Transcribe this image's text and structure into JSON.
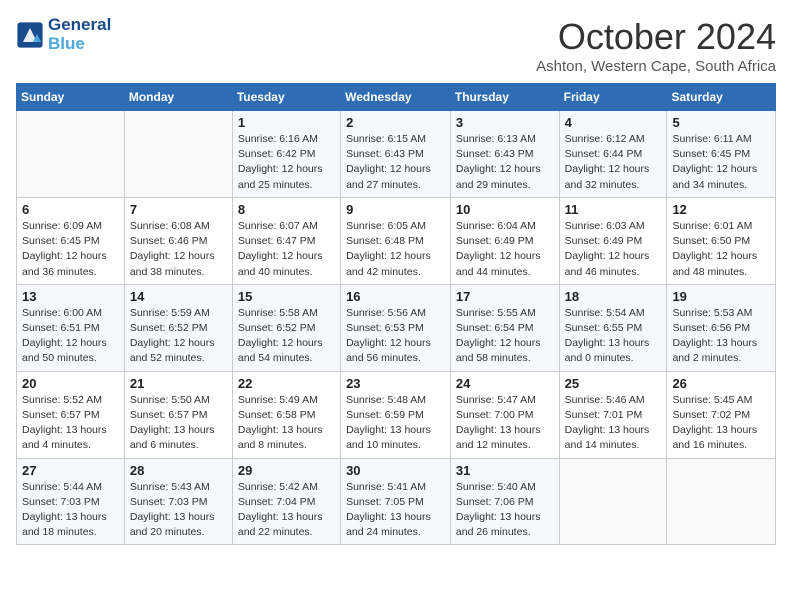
{
  "header": {
    "logo_line1": "General",
    "logo_line2": "Blue",
    "month": "October 2024",
    "location": "Ashton, Western Cape, South Africa"
  },
  "weekdays": [
    "Sunday",
    "Monday",
    "Tuesday",
    "Wednesday",
    "Thursday",
    "Friday",
    "Saturday"
  ],
  "weeks": [
    [
      {
        "day": "",
        "sunrise": "",
        "sunset": "",
        "daylight": ""
      },
      {
        "day": "",
        "sunrise": "",
        "sunset": "",
        "daylight": ""
      },
      {
        "day": "1",
        "sunrise": "Sunrise: 6:16 AM",
        "sunset": "Sunset: 6:42 PM",
        "daylight": "Daylight: 12 hours and 25 minutes."
      },
      {
        "day": "2",
        "sunrise": "Sunrise: 6:15 AM",
        "sunset": "Sunset: 6:43 PM",
        "daylight": "Daylight: 12 hours and 27 minutes."
      },
      {
        "day": "3",
        "sunrise": "Sunrise: 6:13 AM",
        "sunset": "Sunset: 6:43 PM",
        "daylight": "Daylight: 12 hours and 29 minutes."
      },
      {
        "day": "4",
        "sunrise": "Sunrise: 6:12 AM",
        "sunset": "Sunset: 6:44 PM",
        "daylight": "Daylight: 12 hours and 32 minutes."
      },
      {
        "day": "5",
        "sunrise": "Sunrise: 6:11 AM",
        "sunset": "Sunset: 6:45 PM",
        "daylight": "Daylight: 12 hours and 34 minutes."
      }
    ],
    [
      {
        "day": "6",
        "sunrise": "Sunrise: 6:09 AM",
        "sunset": "Sunset: 6:45 PM",
        "daylight": "Daylight: 12 hours and 36 minutes."
      },
      {
        "day": "7",
        "sunrise": "Sunrise: 6:08 AM",
        "sunset": "Sunset: 6:46 PM",
        "daylight": "Daylight: 12 hours and 38 minutes."
      },
      {
        "day": "8",
        "sunrise": "Sunrise: 6:07 AM",
        "sunset": "Sunset: 6:47 PM",
        "daylight": "Daylight: 12 hours and 40 minutes."
      },
      {
        "day": "9",
        "sunrise": "Sunrise: 6:05 AM",
        "sunset": "Sunset: 6:48 PM",
        "daylight": "Daylight: 12 hours and 42 minutes."
      },
      {
        "day": "10",
        "sunrise": "Sunrise: 6:04 AM",
        "sunset": "Sunset: 6:49 PM",
        "daylight": "Daylight: 12 hours and 44 minutes."
      },
      {
        "day": "11",
        "sunrise": "Sunrise: 6:03 AM",
        "sunset": "Sunset: 6:49 PM",
        "daylight": "Daylight: 12 hours and 46 minutes."
      },
      {
        "day": "12",
        "sunrise": "Sunrise: 6:01 AM",
        "sunset": "Sunset: 6:50 PM",
        "daylight": "Daylight: 12 hours and 48 minutes."
      }
    ],
    [
      {
        "day": "13",
        "sunrise": "Sunrise: 6:00 AM",
        "sunset": "Sunset: 6:51 PM",
        "daylight": "Daylight: 12 hours and 50 minutes."
      },
      {
        "day": "14",
        "sunrise": "Sunrise: 5:59 AM",
        "sunset": "Sunset: 6:52 PM",
        "daylight": "Daylight: 12 hours and 52 minutes."
      },
      {
        "day": "15",
        "sunrise": "Sunrise: 5:58 AM",
        "sunset": "Sunset: 6:52 PM",
        "daylight": "Daylight: 12 hours and 54 minutes."
      },
      {
        "day": "16",
        "sunrise": "Sunrise: 5:56 AM",
        "sunset": "Sunset: 6:53 PM",
        "daylight": "Daylight: 12 hours and 56 minutes."
      },
      {
        "day": "17",
        "sunrise": "Sunrise: 5:55 AM",
        "sunset": "Sunset: 6:54 PM",
        "daylight": "Daylight: 12 hours and 58 minutes."
      },
      {
        "day": "18",
        "sunrise": "Sunrise: 5:54 AM",
        "sunset": "Sunset: 6:55 PM",
        "daylight": "Daylight: 13 hours and 0 minutes."
      },
      {
        "day": "19",
        "sunrise": "Sunrise: 5:53 AM",
        "sunset": "Sunset: 6:56 PM",
        "daylight": "Daylight: 13 hours and 2 minutes."
      }
    ],
    [
      {
        "day": "20",
        "sunrise": "Sunrise: 5:52 AM",
        "sunset": "Sunset: 6:57 PM",
        "daylight": "Daylight: 13 hours and 4 minutes."
      },
      {
        "day": "21",
        "sunrise": "Sunrise: 5:50 AM",
        "sunset": "Sunset: 6:57 PM",
        "daylight": "Daylight: 13 hours and 6 minutes."
      },
      {
        "day": "22",
        "sunrise": "Sunrise: 5:49 AM",
        "sunset": "Sunset: 6:58 PM",
        "daylight": "Daylight: 13 hours and 8 minutes."
      },
      {
        "day": "23",
        "sunrise": "Sunrise: 5:48 AM",
        "sunset": "Sunset: 6:59 PM",
        "daylight": "Daylight: 13 hours and 10 minutes."
      },
      {
        "day": "24",
        "sunrise": "Sunrise: 5:47 AM",
        "sunset": "Sunset: 7:00 PM",
        "daylight": "Daylight: 13 hours and 12 minutes."
      },
      {
        "day": "25",
        "sunrise": "Sunrise: 5:46 AM",
        "sunset": "Sunset: 7:01 PM",
        "daylight": "Daylight: 13 hours and 14 minutes."
      },
      {
        "day": "26",
        "sunrise": "Sunrise: 5:45 AM",
        "sunset": "Sunset: 7:02 PM",
        "daylight": "Daylight: 13 hours and 16 minutes."
      }
    ],
    [
      {
        "day": "27",
        "sunrise": "Sunrise: 5:44 AM",
        "sunset": "Sunset: 7:03 PM",
        "daylight": "Daylight: 13 hours and 18 minutes."
      },
      {
        "day": "28",
        "sunrise": "Sunrise: 5:43 AM",
        "sunset": "Sunset: 7:03 PM",
        "daylight": "Daylight: 13 hours and 20 minutes."
      },
      {
        "day": "29",
        "sunrise": "Sunrise: 5:42 AM",
        "sunset": "Sunset: 7:04 PM",
        "daylight": "Daylight: 13 hours and 22 minutes."
      },
      {
        "day": "30",
        "sunrise": "Sunrise: 5:41 AM",
        "sunset": "Sunset: 7:05 PM",
        "daylight": "Daylight: 13 hours and 24 minutes."
      },
      {
        "day": "31",
        "sunrise": "Sunrise: 5:40 AM",
        "sunset": "Sunset: 7:06 PM",
        "daylight": "Daylight: 13 hours and 26 minutes."
      },
      {
        "day": "",
        "sunrise": "",
        "sunset": "",
        "daylight": ""
      },
      {
        "day": "",
        "sunrise": "",
        "sunset": "",
        "daylight": ""
      }
    ]
  ]
}
